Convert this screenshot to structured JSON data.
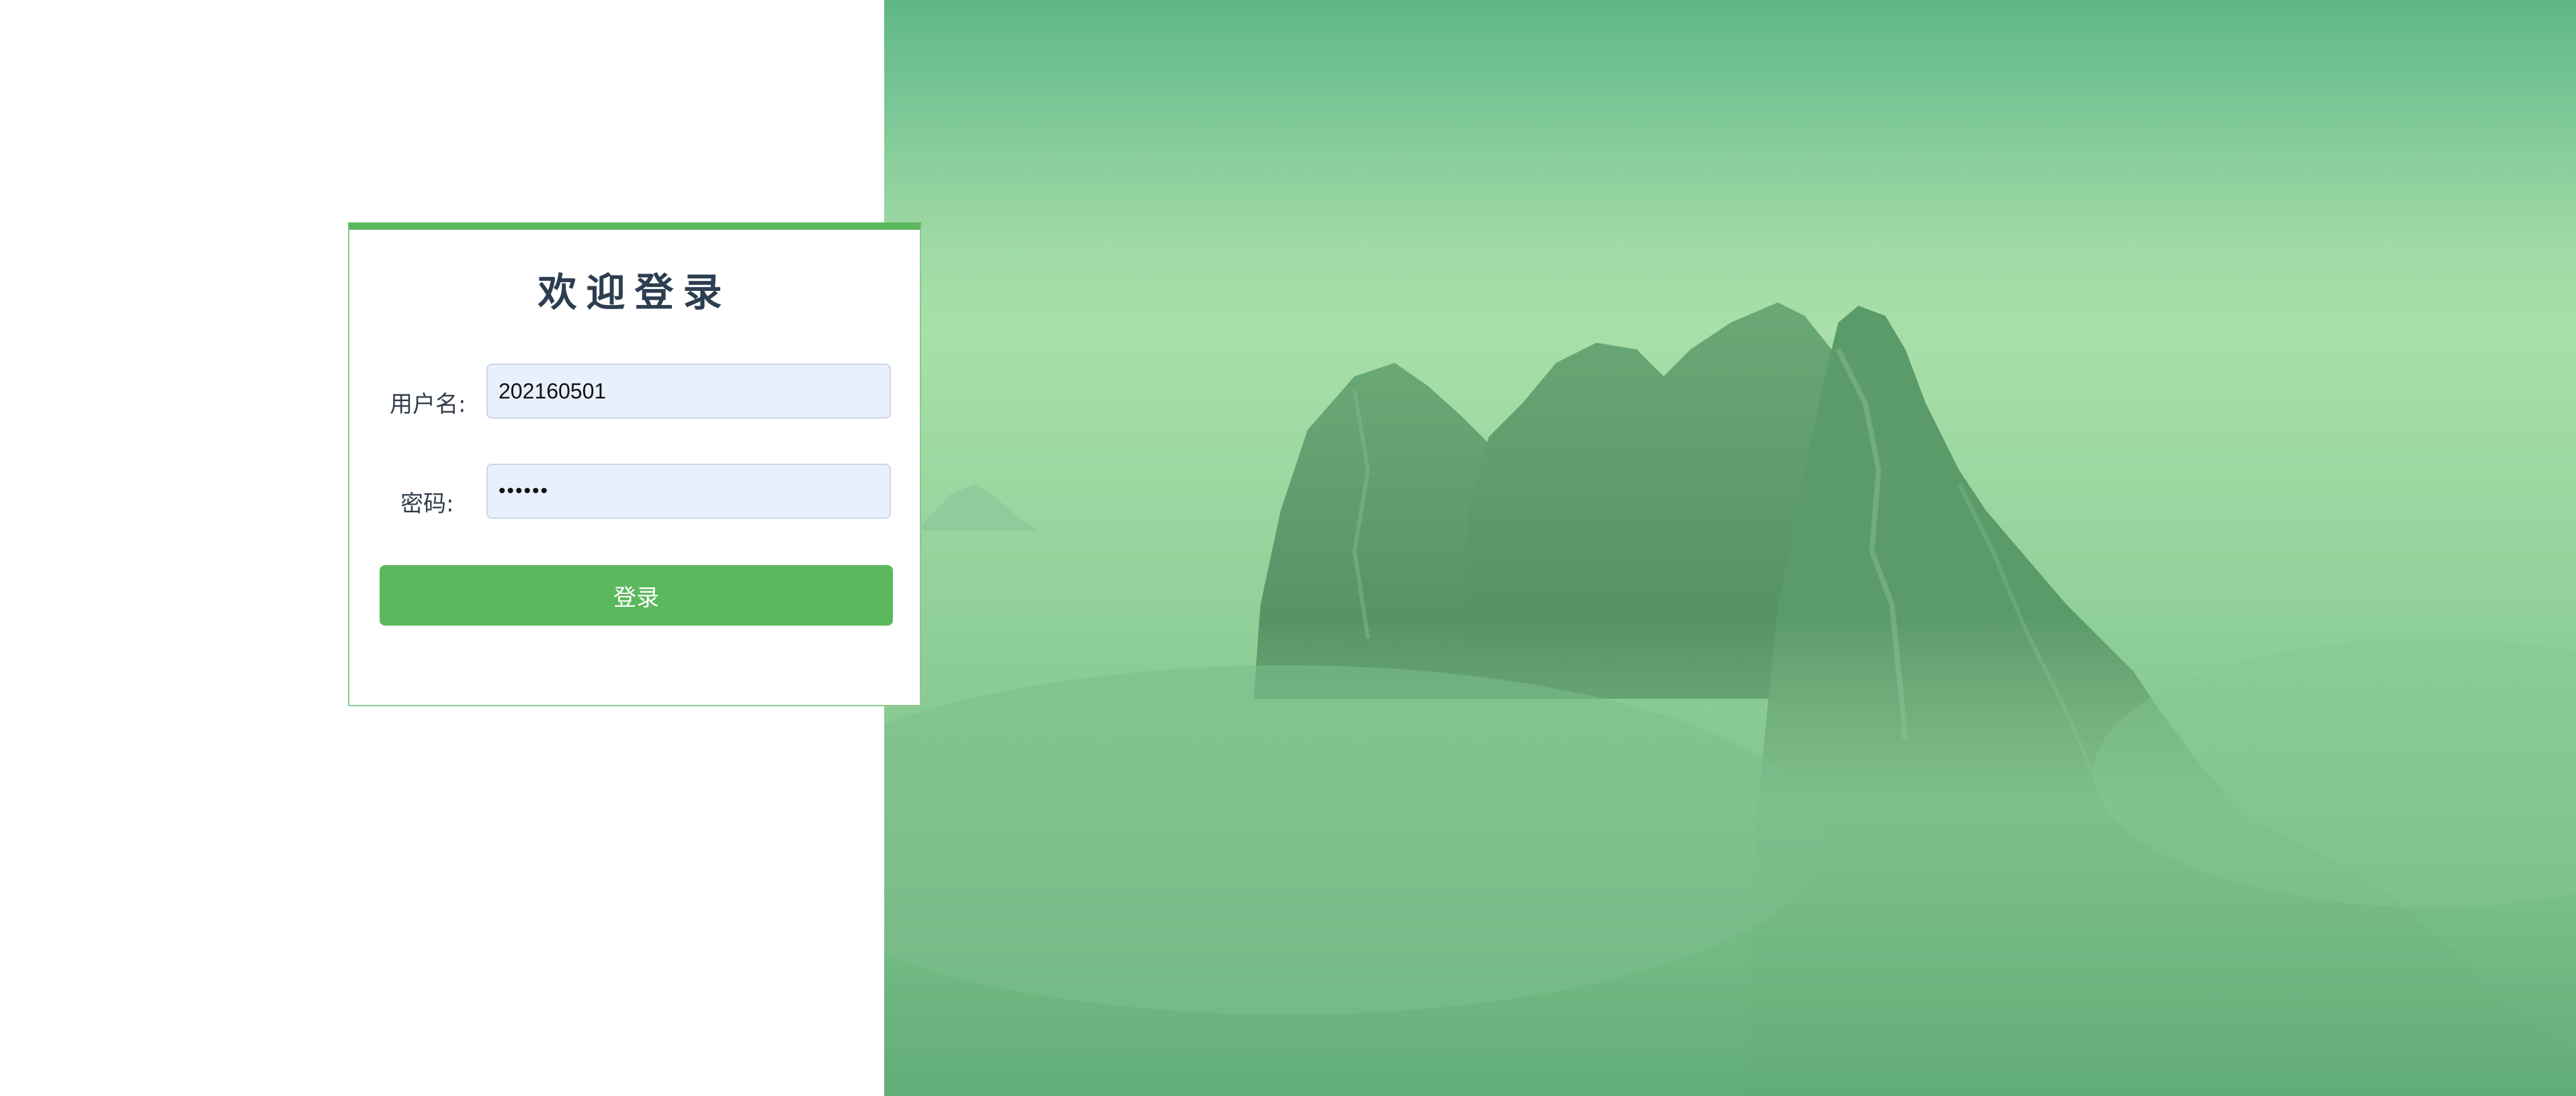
{
  "login": {
    "title": "欢迎登录",
    "username_label": "用户名:",
    "username_value": "202160501",
    "password_label": "密码:",
    "password_value": "202160",
    "submit_label": "登录"
  },
  "colors": {
    "accent": "#5cb85c",
    "title_text": "#2c3e50",
    "input_autofill_bg": "#e8f0fe",
    "hero_tint": "#7cc796"
  },
  "hero_image": {
    "icon": "mountain-landscape-image"
  }
}
